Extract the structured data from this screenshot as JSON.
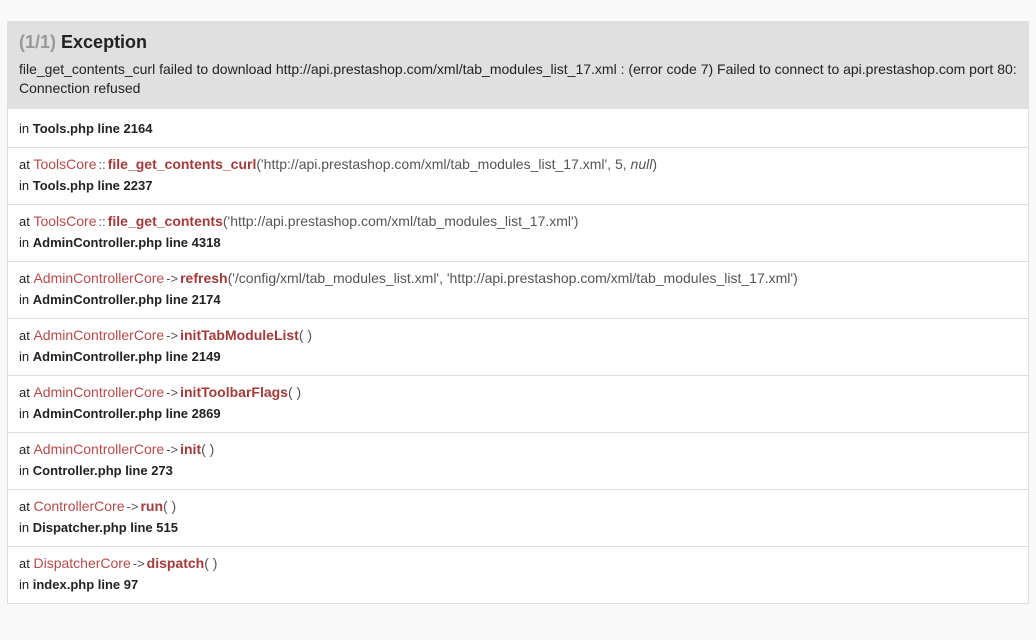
{
  "exception": {
    "count": "(1/1)",
    "title": "Exception",
    "message": "file_get_contents_curl failed to download http://api.prestashop.com/xml/tab_modules_list_17.xml : (error code 7) Failed to connect to api.prestashop.com port 80: Connection refused"
  },
  "labels": {
    "at": "at",
    "in": "in"
  },
  "first_location": "Tools.php line 2164",
  "traces": [
    {
      "class": "ToolsCore",
      "sep": "::",
      "function": "file_get_contents_curl",
      "args_before": "('http://api.prestashop.com/xml/tab_modules_list_17.xml', 5, ",
      "args_italic": "null",
      "args_after": ")",
      "location": "Tools.php line 2237"
    },
    {
      "class": "ToolsCore",
      "sep": "::",
      "function": "file_get_contents",
      "args_before": "('http://api.prestashop.com/xml/tab_modules_list_17.xml')",
      "args_italic": "",
      "args_after": "",
      "location": "AdminController.php line 4318"
    },
    {
      "class": "AdminControllerCore",
      "sep": "->",
      "function": "refresh",
      "args_before": "('/config/xml/tab_modules_list.xml', 'http://api.prestashop.com/xml/tab_modules_list_17.xml')",
      "args_italic": "",
      "args_after": "",
      "location": "AdminController.php line 2174"
    },
    {
      "class": "AdminControllerCore",
      "sep": "->",
      "function": "initTabModuleList",
      "args_before": "( )",
      "args_italic": "",
      "args_after": "",
      "location": "AdminController.php line 2149"
    },
    {
      "class": "AdminControllerCore",
      "sep": "->",
      "function": "initToolbarFlags",
      "args_before": "( )",
      "args_italic": "",
      "args_after": "",
      "location": "AdminController.php line 2869"
    },
    {
      "class": "AdminControllerCore",
      "sep": "->",
      "function": "init",
      "args_before": "( )",
      "args_italic": "",
      "args_after": "",
      "location": "Controller.php line 273"
    },
    {
      "class": "ControllerCore",
      "sep": "->",
      "function": "run",
      "args_before": "( )",
      "args_italic": "",
      "args_after": "",
      "location": "Dispatcher.php line 515"
    },
    {
      "class": "DispatcherCore",
      "sep": "->",
      "function": "dispatch",
      "args_before": "( )",
      "args_italic": "",
      "args_after": "",
      "location": "index.php line 97"
    }
  ]
}
